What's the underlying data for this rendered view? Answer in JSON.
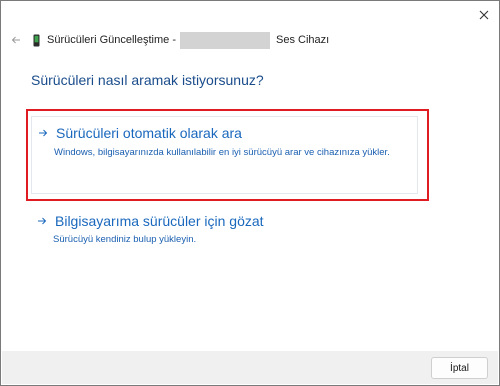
{
  "window": {
    "close_icon": "close-icon"
  },
  "header": {
    "back_icon": "back-arrow-icon",
    "device_icon": "device-phone-icon",
    "title_prefix": "Sürücüleri Güncelleştime -",
    "title_suffix": "Ses Cihazı"
  },
  "main": {
    "question": "Sürücüleri nasıl aramak istiyorsunuz?",
    "options": [
      {
        "arrow_icon": "arrow-right-icon",
        "title": "Sürücüleri otomatik olarak ara",
        "description": "Windows, bilgisayarınızda kullanılabilir en iyi sürücüyü arar ve cihazınıza yükler."
      },
      {
        "arrow_icon": "arrow-right-icon",
        "title": "Bilgisayarıma sürücüler için gözat",
        "description": "Sürücüyü kendiniz bulup yükleyin."
      }
    ],
    "highlight_color": "#e11b22",
    "accent_color": "#1a68bd"
  },
  "footer": {
    "cancel_label": "İptal"
  }
}
